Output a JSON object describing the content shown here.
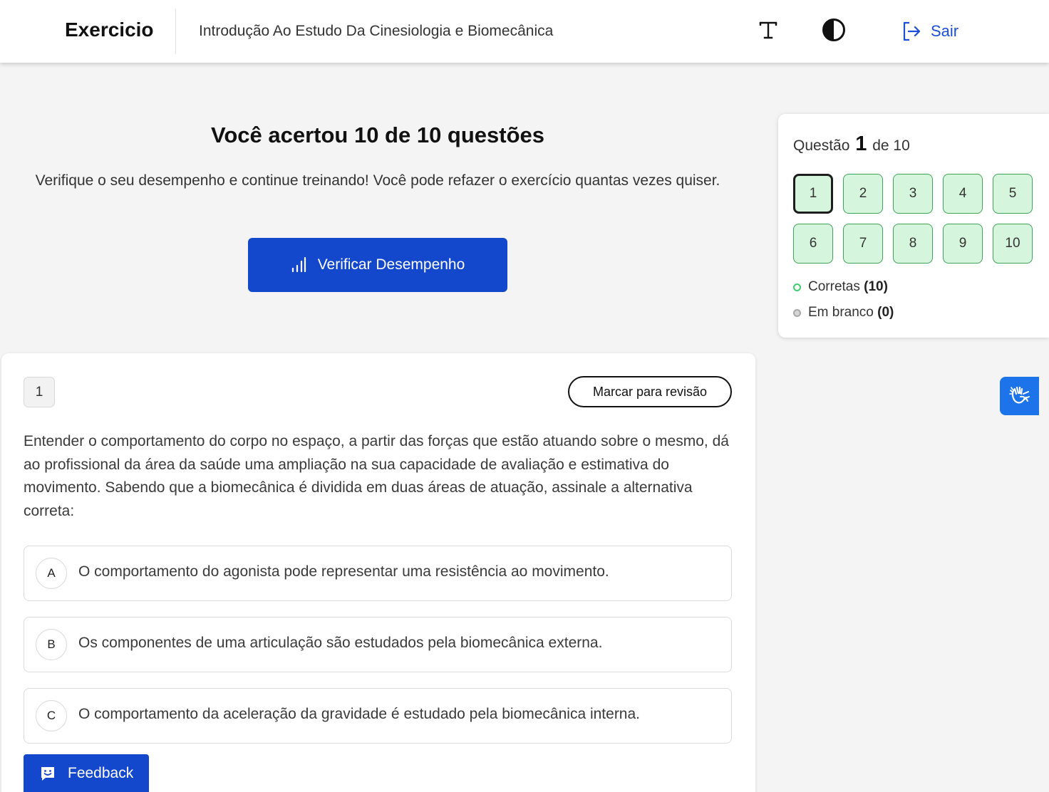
{
  "header": {
    "app_title": "Exercicio",
    "course_title": "Introdução Ao Estudo Da Cinesiologia e Biomecânica",
    "font_icon": "text-size-icon",
    "contrast_icon": "contrast-icon",
    "logout_label": "Sair",
    "logout_icon": "logout-icon"
  },
  "result": {
    "title": "Você acertou 10 de 10 questões",
    "subtitle": "Verifique o seu desempenho e continue treinando! Você pode refazer o exercício quantas vezes quiser.",
    "performance_button": "Verificar Desempenho",
    "performance_icon": "bar-chart-icon"
  },
  "navigator": {
    "prefix": "Questão",
    "current": "1",
    "suffix": "de 10",
    "questions": [
      "1",
      "2",
      "3",
      "4",
      "5",
      "6",
      "7",
      "8",
      "9",
      "10"
    ],
    "legend": {
      "correct_label": "Corretas",
      "correct_count": "(10)",
      "blank_label": "Em branco",
      "blank_count": "(0)"
    }
  },
  "question": {
    "number": "1",
    "review_button": "Marcar para revisão",
    "text": "Entender o comportamento do corpo no espaço, a partir das forças que estão atuando sobre o mesmo, dá ao profissional da área da saúde uma ampliação na sua capacidade de avaliação e estimativa do movimento. Sabendo que a biomecânica é dividida em duas áreas de atuação, assinale a alternativa correta:",
    "options": [
      {
        "letter": "A",
        "text": "O comportamento do agonista pode representar uma resistência ao movimento."
      },
      {
        "letter": "B",
        "text": "Os componentes de uma articulação são estudados pela biomecânica externa."
      },
      {
        "letter": "C",
        "text": "O comportamento da aceleração da gravidade é estudado pela biomecânica interna."
      }
    ]
  },
  "feedback": {
    "label": "Feedback",
    "icon": "feedback-smile-icon"
  },
  "accessibility": {
    "icon": "sign-language-icon"
  },
  "colors": {
    "primary": "#1448cc",
    "link": "#1a4fd6",
    "correct_fill": "#d5f5dc",
    "correct_border": "#3fa35a",
    "accessibility": "#1c73ea"
  }
}
